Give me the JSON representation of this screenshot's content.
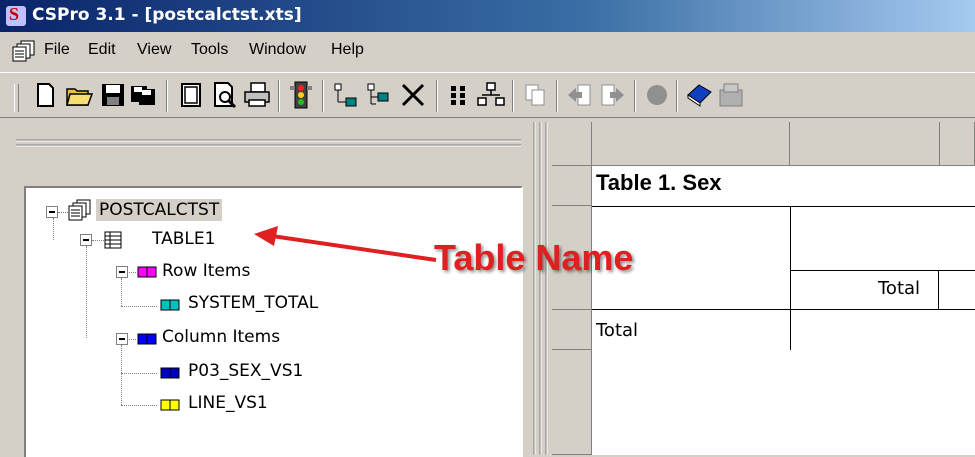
{
  "window": {
    "title": "CSPro 3.1 - [postcalctst.xts]",
    "logo": "S"
  },
  "menu": {
    "items": [
      "File",
      "Edit",
      "View",
      "Tools",
      "Window",
      "Help"
    ]
  },
  "toolbar": {
    "buttons": [
      "new-icon",
      "open-icon",
      "save-icon",
      "save-all-icon",
      "window-icon",
      "print-preview-icon",
      "print-icon",
      "run-icon",
      "add-item-icon",
      "add-subitem-icon",
      "delete-icon",
      "grid-icon",
      "tree-icon",
      "copy-icon",
      "back-icon",
      "forward-icon",
      "record-icon",
      "help-book-icon",
      "extra-icon"
    ]
  },
  "tree": {
    "root": "POSTCALCTST",
    "table": "TABLE1",
    "row_items": "Row Items",
    "row_children": [
      "SYSTEM_TOTAL"
    ],
    "column_items": "Column Items",
    "column_children": [
      "P03_SEX_VS1",
      "LINE_VS1"
    ]
  },
  "annotation": {
    "text": "Table Name",
    "color": "#e02020"
  },
  "table_view": {
    "title": "Table 1. Sex",
    "col_header": "Total",
    "row_label": "Total"
  },
  "colors": {
    "title_bar": "#0a246a",
    "row_items_icon": "#ff00ff",
    "system_total_icon": "#00c0c0",
    "column_items_icon": "#0000ff",
    "p03_icon": "#0000c0",
    "line_icon": "#ffff00"
  }
}
